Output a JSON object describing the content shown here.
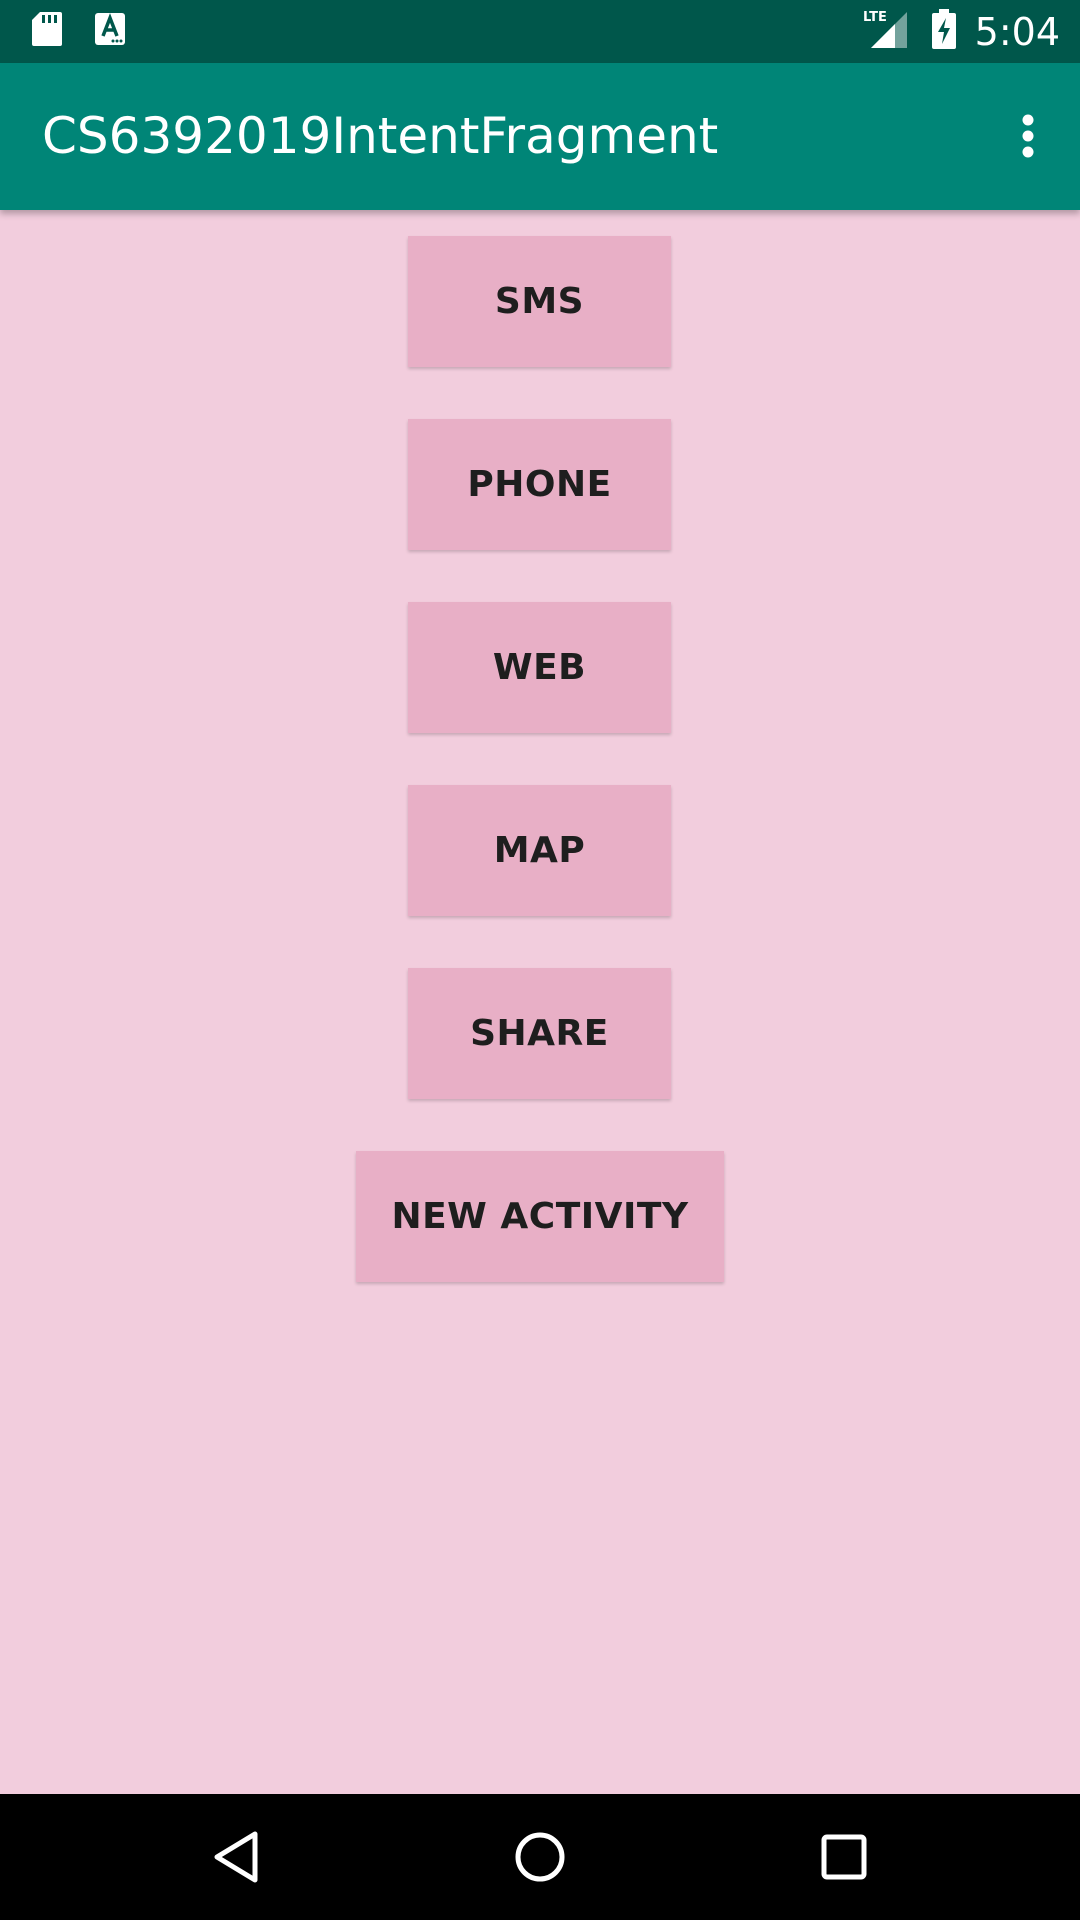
{
  "status_bar": {
    "time": "5:04",
    "network_label": "LTE",
    "icons": [
      "sd-card-icon",
      "a-notification-icon",
      "lte-signal-icon",
      "battery-charging-icon"
    ]
  },
  "app_bar": {
    "title": "CS6392019IntentFragment",
    "menu_icon": "more-vert-icon"
  },
  "buttons": [
    {
      "label": "SMS"
    },
    {
      "label": "PHONE"
    },
    {
      "label": "WEB"
    },
    {
      "label": "MAP"
    },
    {
      "label": "SHARE"
    },
    {
      "label": "NEW ACTIVITY"
    }
  ],
  "nav_bar": {
    "icons": [
      "back-icon",
      "home-icon",
      "recents-icon"
    ]
  },
  "colors": {
    "status_bar": "#00574b",
    "app_bar": "#008577",
    "background": "#f2cddd",
    "button": "#e8afc6"
  }
}
